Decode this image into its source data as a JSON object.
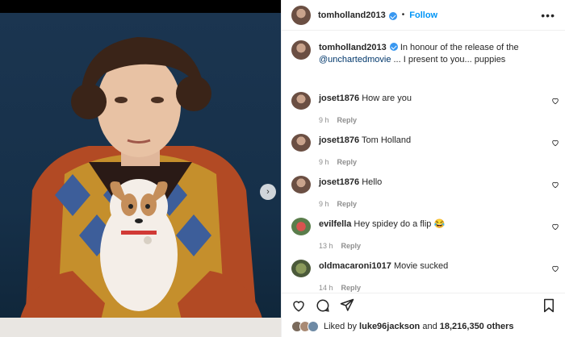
{
  "post": {
    "author": "tomholland2013",
    "follow_label": "Follow",
    "more_label": "•••",
    "dot": "•",
    "caption": {
      "author": "tomholland2013",
      "prefix": "In honour of the release of the",
      "mention": "@unchartedmovie",
      "suffix": "... I present to you... puppies"
    },
    "media": {
      "next_icon": "›"
    },
    "comments": [
      {
        "user": "joset1876",
        "text": "How are you",
        "time": "9 h",
        "reply_label": "Reply"
      },
      {
        "user": "joset1876",
        "text": "Tom Holland",
        "time": "9 h",
        "reply_label": "Reply"
      },
      {
        "user": "joset1876",
        "text": "Hello",
        "time": "9 h",
        "reply_label": "Reply"
      },
      {
        "user": "evilfella",
        "text": "Hey spidey do a flip 😂",
        "time": "13 h",
        "reply_label": "Reply"
      },
      {
        "user": "oldmacaroni1017",
        "text": "Movie sucked",
        "time": "14 h",
        "reply_label": "Reply"
      }
    ],
    "likes": {
      "prefix": "Liked by",
      "user": "luke96jackson",
      "middle": "and",
      "count": "18,216,350 others"
    }
  },
  "colors": {
    "link": "#0095f6",
    "mention": "#00376b",
    "muted": "#8e8e8e"
  },
  "icons": [
    "verified-badge-icon",
    "heart-icon",
    "comment-icon",
    "share-icon",
    "bookmark-icon",
    "chevron-right-icon",
    "more-icon"
  ]
}
